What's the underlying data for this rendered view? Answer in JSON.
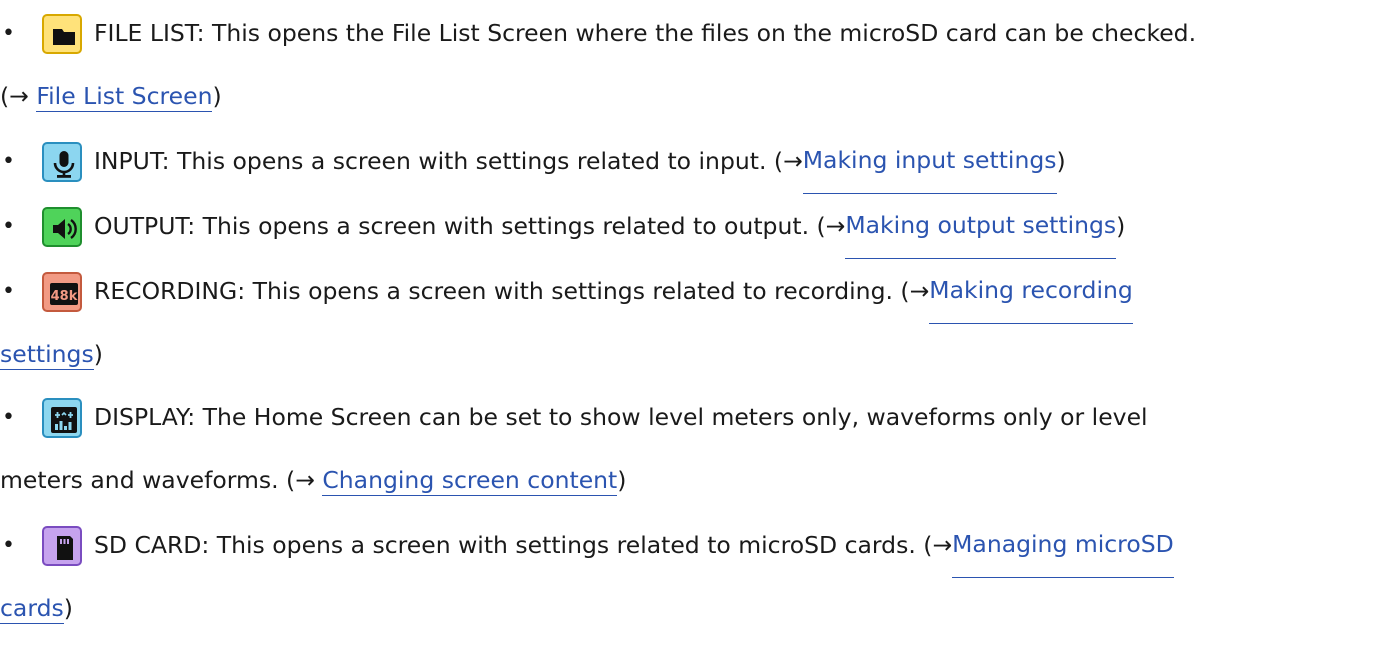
{
  "items": [
    {
      "icon": "folder-icon",
      "icon_color": "#ffe27a",
      "text": "FILE LIST: This opens the File List Screen where the files on the microSD card can be checked.",
      "prefix": "(→ ",
      "link": "File List Screen",
      "suffix": ")"
    },
    {
      "icon": "microphone-icon",
      "icon_color": "#8cd6f0",
      "text": "INPUT: This opens a screen with settings related to input. (→ ",
      "link": "Making input settings",
      "suffix": ")"
    },
    {
      "icon": "speaker-icon",
      "icon_color": "#4fd35a",
      "text": "OUTPUT: This opens a screen with settings related to output. (→ ",
      "link": "Making output settings",
      "suffix": ")"
    },
    {
      "icon": "sample-rate-48k-icon",
      "icon_color": "#f29a84",
      "text": "RECORDING: This opens a screen with settings related to recording. (→ ",
      "link_part1": "Making recording",
      "link_part2": "settings",
      "suffix": ")"
    },
    {
      "icon": "display-meters-icon",
      "icon_color": "#8ed7ef",
      "text": "DISPLAY: The Home Screen can be set to show level meters only, waveforms only or level",
      "prefix": "meters and waveforms. (→ ",
      "link": "Changing screen content",
      "suffix": ")"
    },
    {
      "icon": "sd-card-icon",
      "icon_color": "#c6a3ee",
      "text": "SD CARD: This opens a screen with settings related to microSD cards. (→ ",
      "link_part1": "Managing microSD",
      "link_part2": "cards",
      "suffix": ")"
    }
  ],
  "bullet": "•"
}
